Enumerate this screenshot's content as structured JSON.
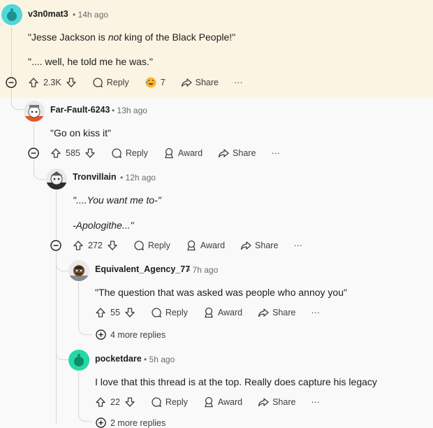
{
  "comments": [
    {
      "username": "v3n0mat3",
      "time": "14h ago",
      "lines": [
        "\"Jesse Jackson is ",
        "not",
        " king of the Black People!\""
      ],
      "line2": "\".... well, he told me he was.\"",
      "votes": "2.3K",
      "reply": "Reply",
      "award_count": "7",
      "share": "Share"
    },
    {
      "username": "Far-Fault-6243",
      "time": "13h ago",
      "text": "\"Go on kiss it\"",
      "votes": "585",
      "reply": "Reply",
      "award": "Award",
      "share": "Share"
    },
    {
      "username": "Tronvillain",
      "time": "12h ago",
      "line1": "\"....You want me to-\"",
      "line2": "-Apologithe...\"",
      "votes": "272",
      "reply": "Reply",
      "award": "Award",
      "share": "Share"
    },
    {
      "username": "Equivalent_Agency_77",
      "time": "7h ago",
      "text": "\"The question that was asked was people who annoy you\"",
      "votes": "55",
      "reply": "Reply",
      "award": "Award",
      "share": "Share",
      "more_replies": "4 more replies"
    },
    {
      "username": "pocketdare",
      "time": "5h ago",
      "text": "I love that this thread is at the top. Really does capture his legacy",
      "votes": "22",
      "reply": "Reply",
      "award": "Award",
      "share": "Share",
      "more_replies": "2 more replies"
    }
  ],
  "ui": {
    "dot": "•",
    "more": "···"
  },
  "colors": {
    "highlight_bg": "#fbf4e3",
    "avatar_teal": "#4fd8d8",
    "avatar_pocket": "#24d8a8"
  }
}
